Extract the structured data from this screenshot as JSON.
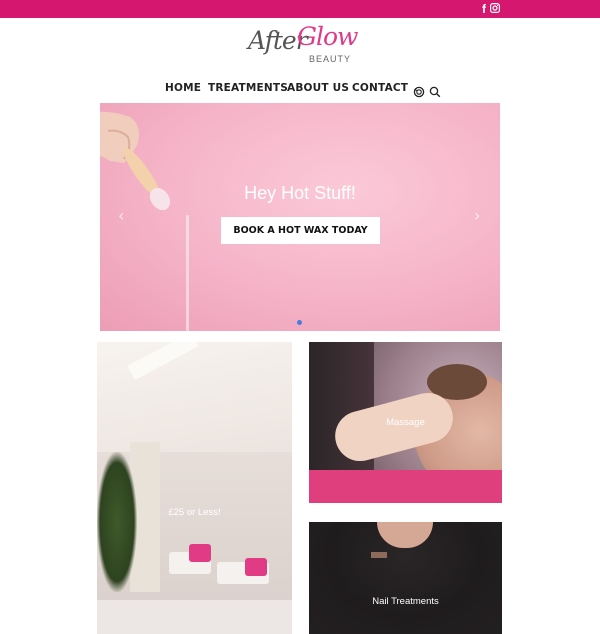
{
  "topbar": {
    "color": "#d6176f",
    "social": [
      {
        "icon": "facebook-icon",
        "glyph": "f"
      },
      {
        "icon": "instagram-icon"
      }
    ]
  },
  "logo": {
    "part1": "After",
    "part2": "Glow",
    "part3": "BEAUTY",
    "accent": "#e0398a"
  },
  "nav": {
    "items": [
      "HOME",
      "TREATMENTS",
      "ABOUT US",
      "CONTACT"
    ],
    "icons": [
      "lens-icon",
      "search-icon"
    ]
  },
  "hero": {
    "title": "Hey Hot Stuff!",
    "button": "BOOK A HOT WAX TODAY",
    "prev": "‹",
    "next": "›",
    "slide_count": 1,
    "dot_color": "#4a7ce0"
  },
  "tiles": [
    {
      "label": "£25 or Less!"
    },
    {
      "label": "Massage"
    },
    {
      "label": "Nail Treatments"
    }
  ]
}
